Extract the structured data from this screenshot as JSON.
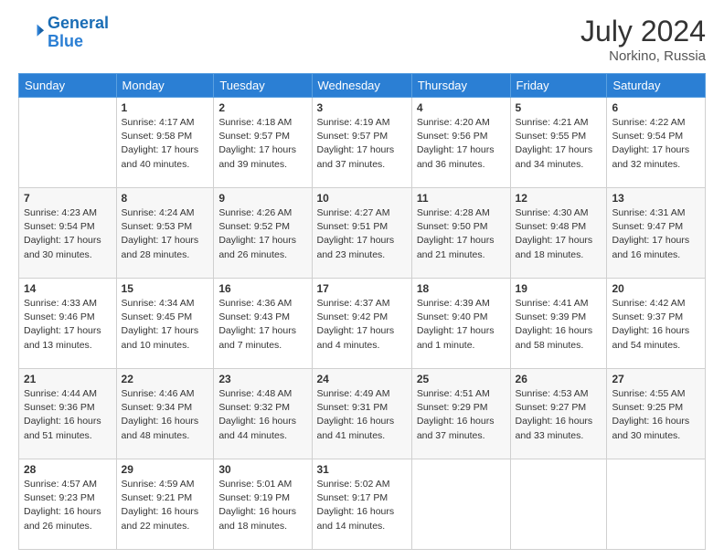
{
  "header": {
    "logo_line1": "General",
    "logo_line2": "Blue",
    "month_year": "July 2024",
    "location": "Norkino, Russia"
  },
  "weekdays": [
    "Sunday",
    "Monday",
    "Tuesday",
    "Wednesday",
    "Thursday",
    "Friday",
    "Saturday"
  ],
  "weeks": [
    [
      {
        "day": "",
        "info": ""
      },
      {
        "day": "1",
        "info": "Sunrise: 4:17 AM\nSunset: 9:58 PM\nDaylight: 17 hours\nand 40 minutes."
      },
      {
        "day": "2",
        "info": "Sunrise: 4:18 AM\nSunset: 9:57 PM\nDaylight: 17 hours\nand 39 minutes."
      },
      {
        "day": "3",
        "info": "Sunrise: 4:19 AM\nSunset: 9:57 PM\nDaylight: 17 hours\nand 37 minutes."
      },
      {
        "day": "4",
        "info": "Sunrise: 4:20 AM\nSunset: 9:56 PM\nDaylight: 17 hours\nand 36 minutes."
      },
      {
        "day": "5",
        "info": "Sunrise: 4:21 AM\nSunset: 9:55 PM\nDaylight: 17 hours\nand 34 minutes."
      },
      {
        "day": "6",
        "info": "Sunrise: 4:22 AM\nSunset: 9:54 PM\nDaylight: 17 hours\nand 32 minutes."
      }
    ],
    [
      {
        "day": "7",
        "info": "Sunrise: 4:23 AM\nSunset: 9:54 PM\nDaylight: 17 hours\nand 30 minutes."
      },
      {
        "day": "8",
        "info": "Sunrise: 4:24 AM\nSunset: 9:53 PM\nDaylight: 17 hours\nand 28 minutes."
      },
      {
        "day": "9",
        "info": "Sunrise: 4:26 AM\nSunset: 9:52 PM\nDaylight: 17 hours\nand 26 minutes."
      },
      {
        "day": "10",
        "info": "Sunrise: 4:27 AM\nSunset: 9:51 PM\nDaylight: 17 hours\nand 23 minutes."
      },
      {
        "day": "11",
        "info": "Sunrise: 4:28 AM\nSunset: 9:50 PM\nDaylight: 17 hours\nand 21 minutes."
      },
      {
        "day": "12",
        "info": "Sunrise: 4:30 AM\nSunset: 9:48 PM\nDaylight: 17 hours\nand 18 minutes."
      },
      {
        "day": "13",
        "info": "Sunrise: 4:31 AM\nSunset: 9:47 PM\nDaylight: 17 hours\nand 16 minutes."
      }
    ],
    [
      {
        "day": "14",
        "info": "Sunrise: 4:33 AM\nSunset: 9:46 PM\nDaylight: 17 hours\nand 13 minutes."
      },
      {
        "day": "15",
        "info": "Sunrise: 4:34 AM\nSunset: 9:45 PM\nDaylight: 17 hours\nand 10 minutes."
      },
      {
        "day": "16",
        "info": "Sunrise: 4:36 AM\nSunset: 9:43 PM\nDaylight: 17 hours\nand 7 minutes."
      },
      {
        "day": "17",
        "info": "Sunrise: 4:37 AM\nSunset: 9:42 PM\nDaylight: 17 hours\nand 4 minutes."
      },
      {
        "day": "18",
        "info": "Sunrise: 4:39 AM\nSunset: 9:40 PM\nDaylight: 17 hours\nand 1 minute."
      },
      {
        "day": "19",
        "info": "Sunrise: 4:41 AM\nSunset: 9:39 PM\nDaylight: 16 hours\nand 58 minutes."
      },
      {
        "day": "20",
        "info": "Sunrise: 4:42 AM\nSunset: 9:37 PM\nDaylight: 16 hours\nand 54 minutes."
      }
    ],
    [
      {
        "day": "21",
        "info": "Sunrise: 4:44 AM\nSunset: 9:36 PM\nDaylight: 16 hours\nand 51 minutes."
      },
      {
        "day": "22",
        "info": "Sunrise: 4:46 AM\nSunset: 9:34 PM\nDaylight: 16 hours\nand 48 minutes."
      },
      {
        "day": "23",
        "info": "Sunrise: 4:48 AM\nSunset: 9:32 PM\nDaylight: 16 hours\nand 44 minutes."
      },
      {
        "day": "24",
        "info": "Sunrise: 4:49 AM\nSunset: 9:31 PM\nDaylight: 16 hours\nand 41 minutes."
      },
      {
        "day": "25",
        "info": "Sunrise: 4:51 AM\nSunset: 9:29 PM\nDaylight: 16 hours\nand 37 minutes."
      },
      {
        "day": "26",
        "info": "Sunrise: 4:53 AM\nSunset: 9:27 PM\nDaylight: 16 hours\nand 33 minutes."
      },
      {
        "day": "27",
        "info": "Sunrise: 4:55 AM\nSunset: 9:25 PM\nDaylight: 16 hours\nand 30 minutes."
      }
    ],
    [
      {
        "day": "28",
        "info": "Sunrise: 4:57 AM\nSunset: 9:23 PM\nDaylight: 16 hours\nand 26 minutes."
      },
      {
        "day": "29",
        "info": "Sunrise: 4:59 AM\nSunset: 9:21 PM\nDaylight: 16 hours\nand 22 minutes."
      },
      {
        "day": "30",
        "info": "Sunrise: 5:01 AM\nSunset: 9:19 PM\nDaylight: 16 hours\nand 18 minutes."
      },
      {
        "day": "31",
        "info": "Sunrise: 5:02 AM\nSunset: 9:17 PM\nDaylight: 16 hours\nand 14 minutes."
      },
      {
        "day": "",
        "info": ""
      },
      {
        "day": "",
        "info": ""
      },
      {
        "day": "",
        "info": ""
      }
    ]
  ]
}
